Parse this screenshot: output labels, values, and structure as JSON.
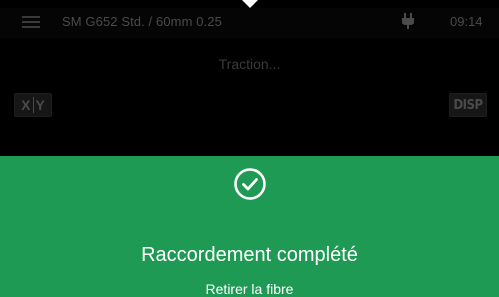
{
  "status_bar": {
    "profile": "SM G652 Std. / 60mm 0.25",
    "time": "09:14",
    "menu_icon": "menu-icon",
    "power_icon": "plug-icon"
  },
  "process": {
    "status_text": "Traction..."
  },
  "controls": {
    "xy_left": "X",
    "xy_right": "Y",
    "disp_label": "DISP"
  },
  "result": {
    "icon": "check-circle-icon",
    "title": "Raccordement complété",
    "subtitle": "Retirer la fibre",
    "color": "#1f9a55"
  }
}
